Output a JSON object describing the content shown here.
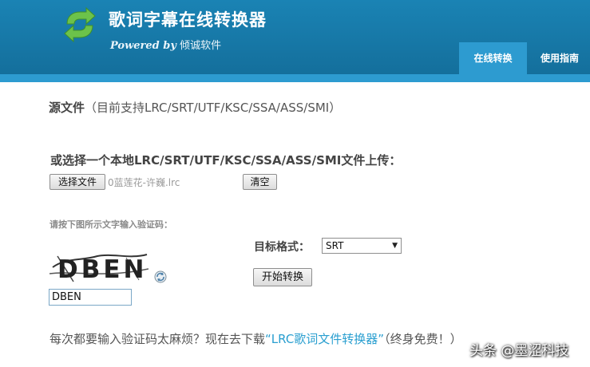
{
  "header": {
    "app_title": "歌词字幕在线转换器",
    "powered_by": "Powered by",
    "vendor": "倾诚软件",
    "tabs": [
      {
        "label": "在线转换",
        "active": true
      },
      {
        "label": "使用指南",
        "active": false
      }
    ],
    "logo_icon": "refresh-arrows-icon"
  },
  "source": {
    "title": "源文件",
    "supported": "（目前支持LRC/SRT/UTF/KSC/SSA/ASS/SMI）"
  },
  "upload": {
    "title": "或选择一个本地LRC/SRT/UTF/KSC/SSA/ASS/SMI文件上传：",
    "choose_button": "选择文件",
    "file_name": "0蓝莲花-许巍.lrc",
    "clear_button": "清空"
  },
  "captcha": {
    "label": "请按下图所示文字输入验证码：",
    "image_text": "DBEN",
    "input_value": "DBEN",
    "refresh_icon": "refresh-icon"
  },
  "format": {
    "label": "目标格式：",
    "selected": "SRT",
    "arrow": "▼"
  },
  "convert_button": "开始转换",
  "footer": {
    "prefix": "每次都要输入验证码太麻烦？现在去下载",
    "link": "“LRC歌词文件转换器”",
    "suffix": "（终身免费！）"
  },
  "watermark": "头条 @墨涩科技",
  "colors": {
    "header_bg": "#1a83b4",
    "accent": "#2d9bd0",
    "link": "#2a9fd0",
    "logo_green": "#6cc24a"
  }
}
